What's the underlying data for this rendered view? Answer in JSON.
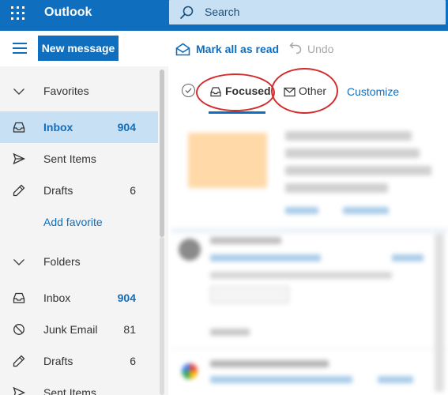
{
  "header": {
    "app_title": "Outlook",
    "search_placeholder": "Search",
    "waffle_icon": "app-launcher-icon",
    "search_icon": "search-icon"
  },
  "toolbar": {
    "new_message": "New message",
    "mark_all_read": "Mark all as read",
    "undo": "Undo"
  },
  "sidebar": {
    "favorites": {
      "heading": "Favorites",
      "items": [
        {
          "label": "Inbox",
          "count": "904",
          "icon": "inbox-icon",
          "selected": true
        },
        {
          "label": "Sent Items",
          "count": "",
          "icon": "send-icon"
        },
        {
          "label": "Drafts",
          "count": "6",
          "icon": "pencil-icon"
        }
      ],
      "add_favorite": "Add favorite"
    },
    "folders": {
      "heading": "Folders",
      "items": [
        {
          "label": "Inbox",
          "count": "904",
          "icon": "inbox-icon"
        },
        {
          "label": "Junk Email",
          "count": "81",
          "icon": "block-icon"
        },
        {
          "label": "Drafts",
          "count": "6",
          "icon": "pencil-icon"
        },
        {
          "label": "Sent Items",
          "count": "",
          "icon": "send-icon"
        }
      ]
    }
  },
  "message_list": {
    "tabs": [
      {
        "label": "Focused",
        "selected": true
      },
      {
        "label": "Other",
        "selected": false
      }
    ],
    "customize": "Customize"
  },
  "colors": {
    "brand": "#106ebe",
    "selected_bg": "#c7e0f4",
    "annotation": "#d22d2d"
  }
}
